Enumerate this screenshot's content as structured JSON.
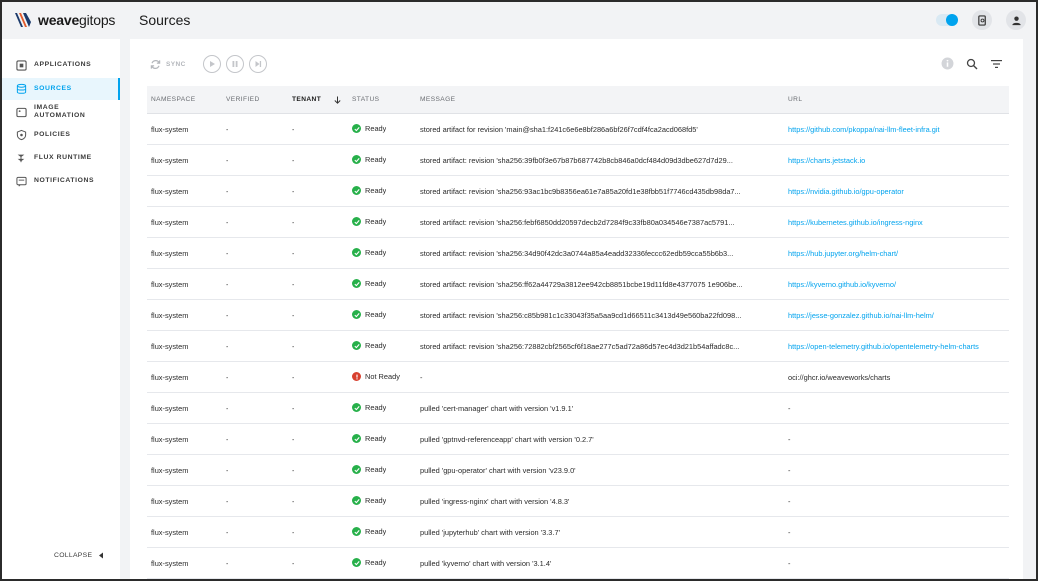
{
  "app": {
    "name_bold": "weave",
    "name_light": "gitops"
  },
  "header": {
    "title": "Sources"
  },
  "colors": {
    "accent": "#00a3ee",
    "ready": "#27b04a",
    "not_ready": "#d8402f"
  },
  "sidebar": {
    "items": [
      {
        "label": "APPLICATIONS",
        "icon": "applications-icon",
        "active": false
      },
      {
        "label": "SOURCES",
        "icon": "sources-icon",
        "active": true
      },
      {
        "label": "IMAGE AUTOMATION",
        "icon": "image-automation-icon",
        "active": false
      },
      {
        "label": "POLICIES",
        "icon": "policies-icon",
        "active": false
      },
      {
        "label": "FLUX RUNTIME",
        "icon": "flux-runtime-icon",
        "active": false
      },
      {
        "label": "NOTIFICATIONS",
        "icon": "notifications-icon",
        "active": false
      }
    ],
    "collapse_label": "COLLAPSE"
  },
  "toolbar": {
    "sync_label": "SYNC"
  },
  "table": {
    "headers": {
      "namespace": "NAMESPACE",
      "verified": "VERIFIED",
      "tenant": "TENANT",
      "status": "STATUS",
      "message": "MESSAGE",
      "url": "URL"
    },
    "rows": [
      {
        "namespace": "flux-system",
        "verified": "-",
        "tenant": "-",
        "status": "Ready",
        "message": "stored artifact for revision 'main@sha1:f241c6e6e8bf286a6bf26f7cdf4fca2acd068fd5'",
        "url": "https://github.com/pkoppa/nai-llm-fleet-infra.git",
        "url_link": true
      },
      {
        "namespace": "flux-system",
        "verified": "-",
        "tenant": "-",
        "status": "Ready",
        "message": "stored artifact: revision 'sha256:39fb0f3e67b87b687742b8cb846a0dcf484d09d3dbe627d7d29...",
        "url": "https://charts.jetstack.io",
        "url_link": true
      },
      {
        "namespace": "flux-system",
        "verified": "-",
        "tenant": "-",
        "status": "Ready",
        "message": "stored artifact: revision 'sha256:93ac1bc9b8356ea61e7a85a20fd1e38fbb51f7746cd435db98da7...",
        "url": "https://nvidia.github.io/gpu-operator",
        "url_link": true
      },
      {
        "namespace": "flux-system",
        "verified": "-",
        "tenant": "-",
        "status": "Ready",
        "message": "stored artifact: revision 'sha256:febf6850dd20597decb2d7284f9c33fb80a034546e7387ac5791...",
        "url": "https://kubernetes.github.io/ingress-nginx",
        "url_link": true
      },
      {
        "namespace": "flux-system",
        "verified": "-",
        "tenant": "-",
        "status": "Ready",
        "message": "stored artifact: revision 'sha256:34d90f42dc3a0744a85a4eadd32336feccc62edb59cca55b6b3...",
        "url": "https://hub.jupyter.org/helm-chart/",
        "url_link": true
      },
      {
        "namespace": "flux-system",
        "verified": "-",
        "tenant": "-",
        "status": "Ready",
        "message": "stored artifact: revision 'sha256:ff62a44729a3812ee942cb8851bcbe19d11fd8e4377075 1e906be...",
        "url": "https://kyverno.github.io/kyverno/",
        "url_link": true
      },
      {
        "namespace": "flux-system",
        "verified": "-",
        "tenant": "-",
        "status": "Ready",
        "message": "stored artifact: revision 'sha256:c85b981c1c33043f35a5aa9cd1d66511c3413d49e560ba22fd098...",
        "url": "https://jesse-gonzalez.github.io/nai-llm-helm/",
        "url_link": true
      },
      {
        "namespace": "flux-system",
        "verified": "-",
        "tenant": "-",
        "status": "Ready",
        "message": "stored artifact: revision 'sha256:72882cbf2565cf6f18ae277c5ad72a86d57ec4d3d21b54affadc8c...",
        "url": "https://open-telemetry.github.io/opentelemetry-helm-charts",
        "url_link": true
      },
      {
        "namespace": "flux-system",
        "verified": "-",
        "tenant": "-",
        "status": "Not Ready",
        "message": "-",
        "url": "oci://ghcr.io/weaveworks/charts",
        "url_link": false
      },
      {
        "namespace": "flux-system",
        "verified": "-",
        "tenant": "-",
        "status": "Ready",
        "message": "pulled 'cert-manager' chart with version 'v1.9.1'",
        "url": "-",
        "url_link": false
      },
      {
        "namespace": "flux-system",
        "verified": "-",
        "tenant": "-",
        "status": "Ready",
        "message": "pulled 'gptnvd-referenceapp' chart with version '0.2.7'",
        "url": "-",
        "url_link": false
      },
      {
        "namespace": "flux-system",
        "verified": "-",
        "tenant": "-",
        "status": "Ready",
        "message": "pulled 'gpu-operator' chart with version 'v23.9.0'",
        "url": "-",
        "url_link": false
      },
      {
        "namespace": "flux-system",
        "verified": "-",
        "tenant": "-",
        "status": "Ready",
        "message": "pulled 'ingress-nginx' chart with version '4.8.3'",
        "url": "-",
        "url_link": false
      },
      {
        "namespace": "flux-system",
        "verified": "-",
        "tenant": "-",
        "status": "Ready",
        "message": "pulled 'jupyterhub' chart with version '3.3.7'",
        "url": "-",
        "url_link": false
      },
      {
        "namespace": "flux-system",
        "verified": "-",
        "tenant": "-",
        "status": "Ready",
        "message": "pulled 'kyverno' chart with version '3.1.4'",
        "url": "-",
        "url_link": false
      }
    ]
  }
}
